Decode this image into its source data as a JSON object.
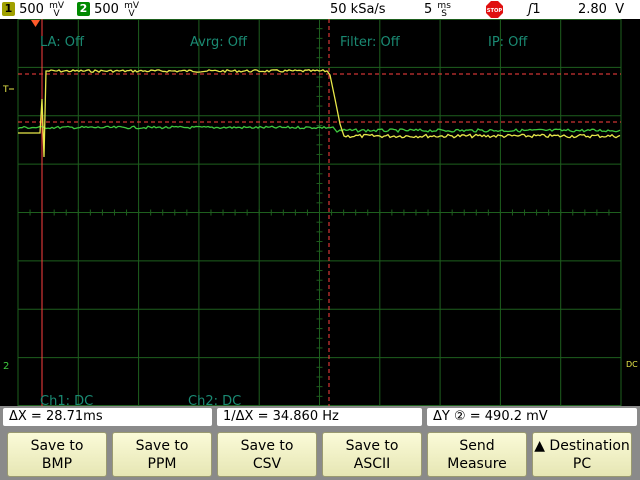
{
  "topbar": {
    "ch1": {
      "number": "1",
      "scale": "500",
      "unit_top": "mV",
      "unit_bottom": "V",
      "color": "#ffff00"
    },
    "ch2": {
      "number": "2",
      "scale": "500",
      "unit_top": "mV",
      "unit_bottom": "V",
      "color": "#00a000"
    },
    "sample_rate": "50 kSa/s",
    "timebase": "5",
    "timebase_unit_top": "ms",
    "timebase_unit_bottom": "S",
    "run_state": "STOP",
    "trigger": "1",
    "trigger_level": "2.80",
    "trigger_level_unit": "V"
  },
  "screen": {
    "labels": {
      "la": "LA: Off",
      "avrg": "Avrg: Off",
      "filter": "Filter: Off",
      "ip": "IP: Off",
      "ch1_coupling": "Ch1: DC",
      "ch2_coupling": "Ch2: DC"
    },
    "marker_t": "T",
    "marker_dc": "DC"
  },
  "measurements": {
    "delta_x": "ΔX = 28.71ms",
    "inv_delta_x": "1/ΔX = 34.860  Hz",
    "delta_y": "ΔY ② = 490.2 mV"
  },
  "softkeys": [
    {
      "line1": "Save to",
      "line2": "BMP"
    },
    {
      "line1": "Save to",
      "line2": "PPM"
    },
    {
      "line1": "Save to",
      "line2": "CSV"
    },
    {
      "line1": "Save to",
      "line2": "ASCII"
    },
    {
      "line1": "Send",
      "line2": "Measure"
    },
    {
      "line1": "▲ Destination",
      "line2": "PC"
    }
  ],
  "colors": {
    "grid": "#1e5f1e",
    "ch1_trace": "#e8e84a",
    "ch2_trace": "#3ec83e",
    "cursor": "#ff4040",
    "label": "#1a8a73"
  }
}
